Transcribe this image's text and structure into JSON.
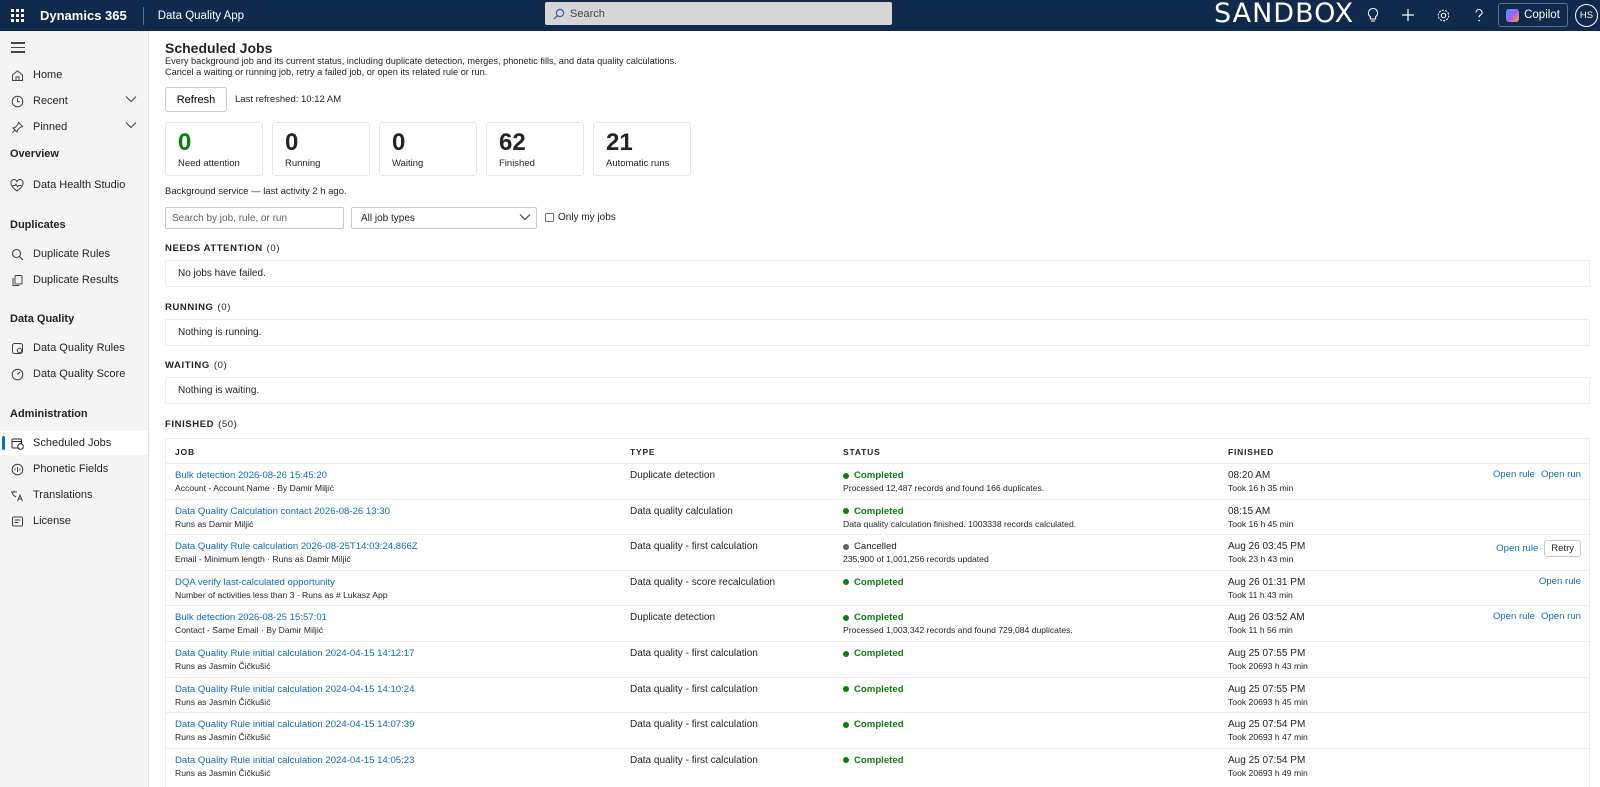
{
  "topbar": {
    "brand": "Dynamics 365",
    "app_name": "Data Quality App",
    "search_placeholder": "Search",
    "environment_label": "SANDBOX",
    "copilot_label": "Copilot",
    "avatar_initials": "HS"
  },
  "sidebar": {
    "items": [
      {
        "label": "Home",
        "icon": "home-icon"
      },
      {
        "label": "Recent",
        "icon": "clock-icon"
      },
      {
        "label": "Pinned",
        "icon": "pin-icon"
      }
    ],
    "sections": [
      {
        "title": "Overview",
        "items": [
          {
            "label": "Data Health Studio",
            "icon": "heart-pulse-icon"
          }
        ]
      },
      {
        "title": "Duplicates",
        "items": [
          {
            "label": "Duplicate Rules",
            "icon": "search-icon"
          },
          {
            "label": "Duplicate Results",
            "icon": "copy-icon"
          }
        ]
      },
      {
        "title": "Data Quality",
        "items": [
          {
            "label": "Data Quality Rules",
            "icon": "rule-check-icon"
          },
          {
            "label": "Data Quality Score",
            "icon": "gauge-icon"
          }
        ]
      },
      {
        "title": "Administration",
        "items": [
          {
            "label": "Scheduled Jobs",
            "icon": "calendar-clock-icon",
            "active": true
          },
          {
            "label": "Phonetic Fields",
            "icon": "phonetic-icon"
          },
          {
            "label": "Translations",
            "icon": "translate-icon"
          },
          {
            "label": "License",
            "icon": "license-icon"
          }
        ]
      }
    ]
  },
  "page": {
    "title": "Scheduled Jobs",
    "description_line1": "Every background job and its current status, including duplicate detection, merges, phonetic fills, and data quality calculations.",
    "description_line2": "Cancel a waiting or running job, retry a failed job, or open its related rule or run.",
    "refresh_label": "Refresh",
    "last_refreshed": "Last refreshed: 10:12 AM",
    "background_service": "Background service — last activity 2 h ago."
  },
  "stats": [
    {
      "value": "0",
      "label": "Need attention"
    },
    {
      "value": "0",
      "label": "Running"
    },
    {
      "value": "0",
      "label": "Waiting"
    },
    {
      "value": "62",
      "label": "Finished"
    },
    {
      "value": "21",
      "label": "Automatic runs"
    }
  ],
  "filters": {
    "search_placeholder": "Search by job, rule, or run",
    "type_selected": "All job types",
    "only_mine_label": "Only my jobs"
  },
  "sections": {
    "needs_attention": {
      "title": "NEEDS ATTENTION",
      "count": "(0)",
      "empty": "No jobs have failed."
    },
    "running": {
      "title": "RUNNING",
      "count": "(0)",
      "empty": "Nothing is running."
    },
    "waiting": {
      "title": "WAITING",
      "count": "(0)",
      "empty": "Nothing is waiting."
    },
    "finished": {
      "title": "FINISHED",
      "count": "(50)"
    }
  },
  "table": {
    "headers": {
      "job": "JOB",
      "type": "TYPE",
      "status": "STATUS",
      "finished": "FINISHED"
    },
    "rows": [
      {
        "job": "Bulk detection 2026-08-26 15:45:20",
        "sub": "Account - Account Name · By Damir Miljić",
        "type": "Duplicate detection",
        "status": "Completed",
        "status_kind": "completed",
        "status_sub": "Processed 12,487 records and found 166 duplicates.",
        "time": "08:20 AM",
        "took": "Took 16 h 35 min",
        "actions": [
          "Open rule",
          "Open run"
        ]
      },
      {
        "job": "Data Quality Calculation contact 2026-08-26 13:30",
        "sub": "Runs as Damir Miljić",
        "type": "Data quality calculation",
        "status": "Completed",
        "status_kind": "completed",
        "status_sub": "Data quality calculation finished. 1003338 records calculated.",
        "time": "08:15 AM",
        "took": "Took 16 h 45 min",
        "actions": []
      },
      {
        "job": "Data Quality Rule calculation 2026-08-25T14:03:24.866Z",
        "sub": "Email - Minimum length · Runs as Damir Miljić",
        "type": "Data quality - first calculation",
        "status": "Cancelled",
        "status_kind": "cancelled",
        "status_sub": "235,900 of 1,001,256 records updated",
        "time": "Aug 26 03:45 PM",
        "took": "Took 23 h 43 min",
        "actions": [
          "Open rule"
        ],
        "retry": "Retry"
      },
      {
        "job": "DQA verify last-calculated opportunity",
        "sub": "Number of activities less than 3 · Runs as # Lukasz App",
        "type": "Data quality - score recalculation",
        "status": "Completed",
        "status_kind": "completed",
        "status_sub": "",
        "time": "Aug 26 01:31 PM",
        "took": "Took 11 h 43 min",
        "actions": [
          "Open rule"
        ]
      },
      {
        "job": "Bulk detection 2026-08-25 15:57:01",
        "sub": "Contact - Same Email · By Damir Miljić",
        "type": "Duplicate detection",
        "status": "Completed",
        "status_kind": "completed",
        "status_sub": "Processed 1,003,342 records and found 729,084 duplicates.",
        "time": "Aug 26 03:52 AM",
        "took": "Took 11 h 56 min",
        "actions": [
          "Open rule",
          "Open run"
        ]
      },
      {
        "job": "Data Quality Rule initial calculation 2024-04-15 14:12:17",
        "sub": "Runs as Jasmin Čičkušić",
        "type": "Data quality - first calculation",
        "status": "Completed",
        "status_kind": "completed",
        "status_sub": "",
        "time": "Aug 25 07:55 PM",
        "took": "Took 20693 h 43 min",
        "actions": []
      },
      {
        "job": "Data Quality Rule initial calculation 2024-04-15 14:10:24",
        "sub": "Runs as Jasmin Čičkušić",
        "type": "Data quality - first calculation",
        "status": "Completed",
        "status_kind": "completed",
        "status_sub": "",
        "time": "Aug 25 07:55 PM",
        "took": "Took 20693 h 45 min",
        "actions": []
      },
      {
        "job": "Data Quality Rule initial calculation 2024-04-15 14:07:39",
        "sub": "Runs as Jasmin Čičkušić",
        "type": "Data quality - first calculation",
        "status": "Completed",
        "status_kind": "completed",
        "status_sub": "",
        "time": "Aug 25 07:54 PM",
        "took": "Took 20693 h 47 min",
        "actions": []
      },
      {
        "job": "Data Quality Rule initial calculation 2024-04-15 14:05:23",
        "sub": "Runs as Jasmin Čičkušić",
        "type": "Data quality - first calculation",
        "status": "Completed",
        "status_kind": "completed",
        "status_sub": "",
        "time": "Aug 25 07:54 PM",
        "took": "Took 20693 h 49 min",
        "actions": []
      }
    ]
  },
  "colors": {
    "topbar": "#0f2a4d",
    "link": "#0f6cbd",
    "success": "#107c10"
  }
}
